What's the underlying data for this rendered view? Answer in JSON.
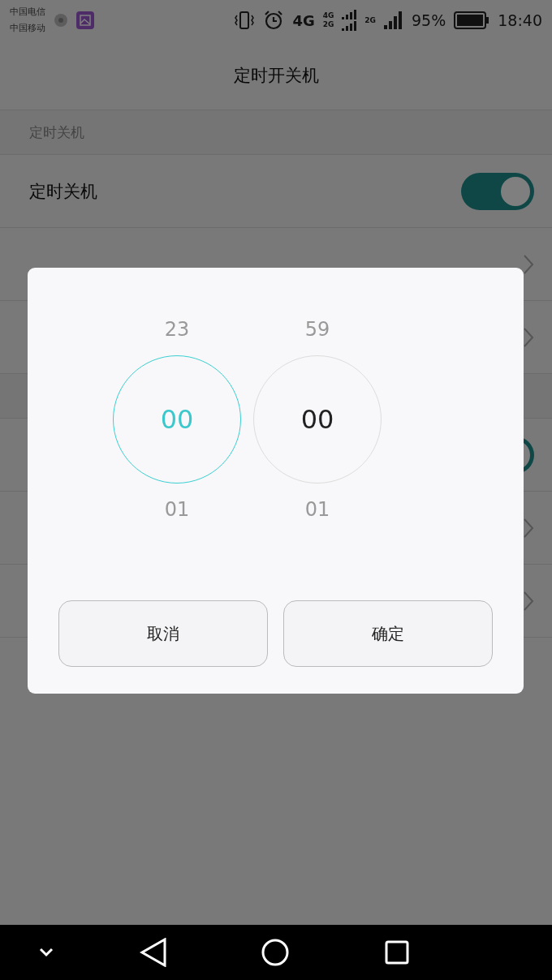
{
  "status_bar": {
    "carriers": [
      "中国电信",
      "中国移动"
    ],
    "network_labels": [
      "4G",
      "4G",
      "2G",
      "2G"
    ],
    "battery": "95%",
    "time": "18:40"
  },
  "title": "定时开关机",
  "sections": [
    {
      "header": "定时关机",
      "rows": [
        {
          "kind": "toggle",
          "label": "定时关机",
          "on": true
        },
        {
          "kind": "link"
        },
        {
          "kind": "link"
        }
      ]
    },
    {
      "rows": [
        {
          "kind": "toggle",
          "on": true
        },
        {
          "kind": "link"
        },
        {
          "kind": "link"
        }
      ]
    }
  ],
  "dialog": {
    "columns": [
      {
        "above": "23",
        "value": "00",
        "below": "01",
        "selected": true
      },
      {
        "above": "59",
        "value": "00",
        "below": "01",
        "selected": false
      }
    ],
    "buttons": [
      "取消",
      "确定"
    ]
  }
}
